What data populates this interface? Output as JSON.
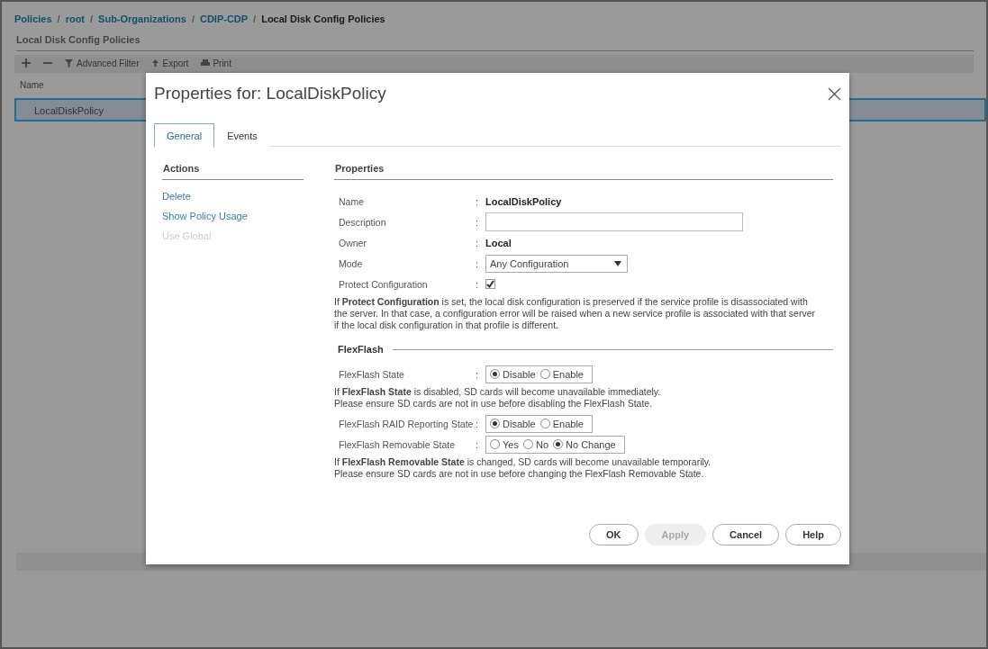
{
  "breadcrumb_separator": "/",
  "field_separator": ":",
  "breadcrumb": [
    {
      "label": "Policies",
      "current": false
    },
    {
      "label": "root",
      "current": false
    },
    {
      "label": "Sub-Organizations",
      "current": false
    },
    {
      "label": "CDIP-CDP",
      "current": false
    },
    {
      "label": "Local Disk Config Policies",
      "current": true
    }
  ],
  "page": {
    "title": "Local Disk Config Policies",
    "toolbar": [
      {
        "kind": "plus"
      },
      {
        "kind": "minus"
      },
      {
        "kind": "filter",
        "label": "Advanced Filter"
      },
      {
        "kind": "export",
        "label": "Export"
      },
      {
        "kind": "print",
        "label": "Print"
      }
    ],
    "table": {
      "columns": [
        "Name"
      ],
      "rows": [
        {
          "name": "LocalDiskPolicy",
          "selected": true
        }
      ]
    }
  },
  "dialog": {
    "title": "Properties for: LocalDiskPolicy",
    "tabs": [
      {
        "label": "General",
        "selected": true
      },
      {
        "label": "Events",
        "selected": false
      }
    ],
    "actions": {
      "title": "Actions",
      "items": [
        {
          "label": "Delete",
          "disabled": false
        },
        {
          "label": "Show Policy Usage",
          "disabled": false
        },
        {
          "label": "Use Global",
          "disabled": true
        }
      ]
    },
    "properties": {
      "title": "Properties",
      "rows": [
        {
          "kind": "text",
          "label": "Name",
          "value": "LocalDiskPolicy"
        },
        {
          "kind": "input",
          "label": "Description"
        },
        {
          "kind": "text",
          "label": "Owner",
          "value": "Local"
        },
        {
          "kind": "select",
          "label": "Mode",
          "value": "Any Configuration"
        },
        {
          "kind": "checkbox",
          "label": "Protect Configuration",
          "checked": true
        },
        {
          "kind": "note",
          "text": "If **Protect Configuration** is set, the local disk configuration is preserved if the service profile is disassociated with the server. In that case, a configuration error will be raised when a new service profile is associated with that server if the local disk configuration in that profile is different."
        }
      ]
    },
    "flexflash": {
      "title": "FlexFlash",
      "rows": [
        {
          "kind": "radio",
          "label": "FlexFlash State",
          "options": [
            {
              "label": "Disable",
              "selected": true
            },
            {
              "label": "Enable",
              "selected": false
            }
          ]
        },
        {
          "kind": "note",
          "text": "If **FlexFlash State** is disabled, SD cards will become unavailable immediately.\nPlease ensure SD cards are not in use before disabling the FlexFlash State."
        },
        {
          "kind": "radio",
          "label": "FlexFlash RAID Reporting State",
          "options": [
            {
              "label": "Disable",
              "selected": true
            },
            {
              "label": "Enable",
              "selected": false
            }
          ]
        },
        {
          "kind": "radio",
          "label": "FlexFlash Removable State",
          "options": [
            {
              "label": "Yes",
              "selected": false
            },
            {
              "label": "No",
              "selected": false
            },
            {
              "label": "No Change",
              "selected": true
            }
          ]
        },
        {
          "kind": "note",
          "text": "If **FlexFlash Removable State** is changed, SD cards will become unavailable temporarily.\nPlease ensure SD cards are not in use before changing the FlexFlash Removable State."
        }
      ]
    },
    "buttons": [
      {
        "label": "OK",
        "disabled": false
      },
      {
        "label": "Apply",
        "disabled": true
      },
      {
        "label": "Cancel",
        "disabled": false
      },
      {
        "label": "Help",
        "disabled": false
      }
    ]
  }
}
